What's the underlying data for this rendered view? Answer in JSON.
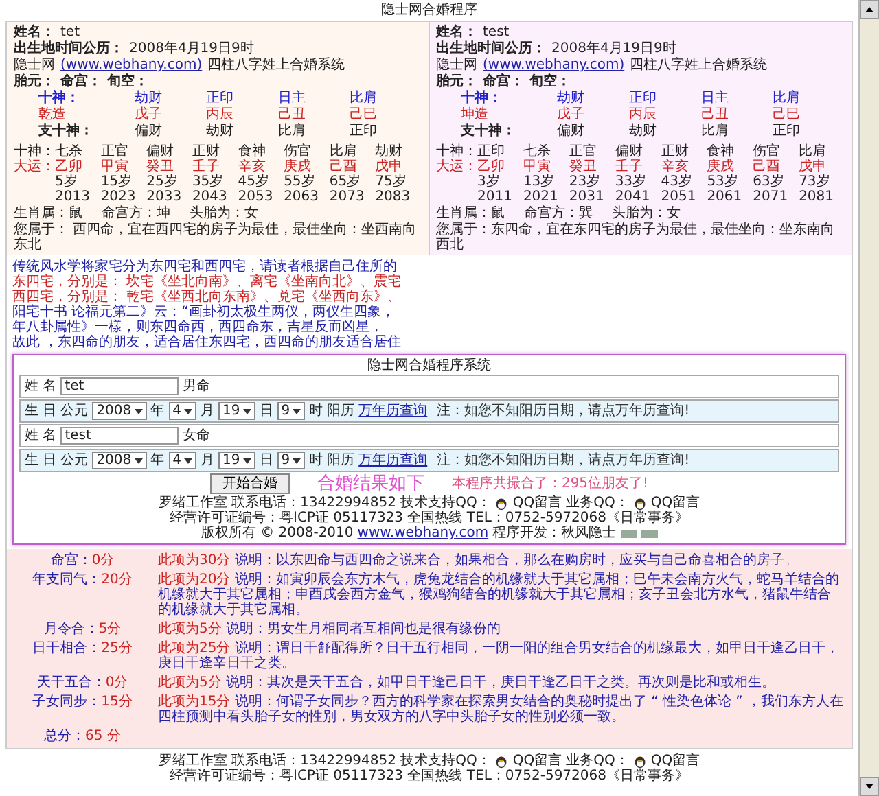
{
  "window": {
    "title": "隐士网合婚程序"
  },
  "panels": [
    {
      "name_label": "姓名：",
      "name": "tet",
      "birth_label": "出生地时间公历：",
      "birth": "2008年4月19日9时",
      "site_prefix": "隐士网",
      "site_link": "(www.webhany.com)",
      "site_suffix": "四柱八字姓上合婚系统",
      "taiyuan": "胎元：",
      "minggong": "命宫：",
      "xunkong": "旬空：",
      "shishen_label": "十神：",
      "shishen": [
        "劫财",
        "正印",
        "日主",
        "比肩"
      ],
      "zao_label": "乾造",
      "pillars": [
        "戊子",
        "丙辰",
        "己丑",
        "己巳"
      ],
      "zhi_label": "支十神：",
      "zhi": [
        "偏财",
        "劫财",
        "比肩",
        "正印"
      ],
      "dayun_shishen_label": "十神：",
      "dayun_shishen": [
        "七杀",
        "正官",
        "偏财",
        "正财",
        "食神",
        "伤官",
        "比肩",
        "劫财"
      ],
      "dayun_label": "大运：",
      "dayun": [
        "乙卯",
        "甲寅",
        "癸丑",
        "壬子",
        "辛亥",
        "庚戌",
        "己酉",
        "戊申"
      ],
      "ages": [
        "5岁",
        "15岁",
        "25岁",
        "35岁",
        "45岁",
        "55岁",
        "65岁",
        "75岁"
      ],
      "years": [
        "2013",
        "2023",
        "2033",
        "2043",
        "2053",
        "2063",
        "2073",
        "2083"
      ],
      "zodiac": "生肖属：鼠",
      "direction": "命宫方：坤",
      "first_child": "头胎为：女",
      "summary": "您属于： 西四命，宜在西四宅的房子为最佳，最佳坐向：坐西南向东北"
    },
    {
      "name_label": "姓名：",
      "name": "test",
      "birth_label": "出生地时间公历：",
      "birth": "2008年4月19日9时",
      "site_prefix": "隐士网",
      "site_link": "(www.webhany.com)",
      "site_suffix": "四柱八字姓上合婚系统",
      "taiyuan": "胎元：",
      "minggong": "命宫：",
      "xunkong": "旬空：",
      "shishen_label": "十神：",
      "shishen": [
        "劫财",
        "正印",
        "日主",
        "比肩"
      ],
      "zao_label": "坤造",
      "pillars": [
        "戊子",
        "丙辰",
        "己丑",
        "己巳"
      ],
      "zhi_label": "支十神：",
      "zhi": [
        "偏财",
        "劫财",
        "比肩",
        "正印"
      ],
      "dayun_shishen_label": "十神：",
      "dayun_shishen": [
        "正印",
        "七杀",
        "正官",
        "偏财",
        "正财",
        "食神",
        "伤官",
        "比肩"
      ],
      "dayun_label": "大运：",
      "dayun": [
        "乙卯",
        "甲寅",
        "癸丑",
        "壬子",
        "辛亥",
        "庚戌",
        "己酉",
        "戊申"
      ],
      "ages": [
        "3岁",
        "13岁",
        "23岁",
        "33岁",
        "43岁",
        "53岁",
        "63岁",
        "73岁"
      ],
      "years": [
        "2011",
        "2021",
        "2031",
        "2041",
        "2051",
        "2061",
        "2071",
        "2081"
      ],
      "zodiac": "生肖属：鼠",
      "direction": "命宫方：巽",
      "first_child": "头胎为：女",
      "summary": "您属于：东四命，宜在东四宅的房子为最佳，最佳坐向：坐东南向西北"
    }
  ],
  "notes": [
    {
      "kind": "plain",
      "text": "传统风水学将家宅分为东四宅和西四宅，请读者根据自己住所的"
    },
    {
      "kind": "emphasis",
      "text": "东四宅，分别是：  坎宅《坐北向南》、离宅《坐南向北》、震宅"
    },
    {
      "kind": "emphasis",
      "text": "西四宅，分别是：  乾宅《坐西北向东南》、兑宅《坐西向东》、"
    },
    {
      "kind": "plain",
      "text": "阳宅十书 论福元第二》云：“画卦初太极生两仪，两仪生四象，"
    },
    {
      "kind": "plain",
      "text": "年八卦属性》一樣，则东四命西，西四命东，吉星反而凶星，"
    },
    {
      "kind": "plain",
      "text": "故此 ，东四命的朋友，适合居住东四宅，西四命的朋友适合居住"
    }
  ],
  "dialog": {
    "title": "隐士网合婚程序系统",
    "rows": [
      {
        "kind": "name",
        "label": "姓 名",
        "value": "tet",
        "gender": "男命"
      },
      {
        "kind": "birth",
        "label": "生 日",
        "era": "公元",
        "year": "2008",
        "year_unit": "年",
        "month": "4",
        "month_unit": "月",
        "day": "19",
        "day_unit": "日",
        "hour": "9",
        "hour_unit": "时",
        "calendar": "阳历",
        "lookup_link": "万年历查询",
        "note": "注：如您不知阳历日期，请点万年历查询!"
      },
      {
        "kind": "name",
        "label": "姓 名",
        "value": "test",
        "gender": "女命"
      },
      {
        "kind": "birth",
        "label": "生 日",
        "era": "公元",
        "year": "2008",
        "year_unit": "年",
        "month": "4",
        "month_unit": "月",
        "day": "19",
        "day_unit": "日",
        "hour": "9",
        "hour_unit": "时",
        "calendar": "阳历",
        "lookup_link": "万年历查询",
        "note": "注：如您不知阳历日期，请点万年历查询!"
      }
    ],
    "button": "开始合婚",
    "result_heading": "合婚结果如下",
    "counter": "本程序共撮合了：295位朋友了!",
    "footer": {
      "contact": "罗绪工作室 联系电话：13422994852 技术支持QQ：",
      "qq1": "QQ留言",
      "biz": "业务QQ：",
      "qq2": "QQ留言",
      "license": "经营许可证编号：粤ICP证 05117323 全国热线 TEL：0752-5972068《日常事务》",
      "copyright": "版权所有 © 2008-2010",
      "site": "www.webhany.com",
      "developer": "程序开发：秋风隐士"
    }
  },
  "results": [
    {
      "label": "命宫：",
      "score": "0分",
      "item_score": "此项为30分",
      "desc": "说明：以东四命与西四命之说来合，如果相合，那么在购房时，应买与自己命喜相合的房子。"
    },
    {
      "label": "年支同气：",
      "score": "20分",
      "item_score": "此项为20分",
      "desc": "说明：如寅卯辰会东方木气，虎兔龙结合的机缘就大于其它属相；巳午未会南方火气，蛇马羊结合的机缘就大于其它属相；申酉戌会西方金气，猴鸡狗结合的机缘就大于其它属相；亥子丑会北方水气，猪鼠牛结合的机缘就大于其它属相。"
    },
    {
      "label": "月令合：",
      "score": "5分",
      "item_score": "此项为5分",
      "desc": "说明：男女生月相同者互相间也是很有缘份的"
    },
    {
      "label": "日干相合：",
      "score": "25分",
      "item_score": "此项为25分",
      "desc": "说明：谓日干舒配得所？日干五行相同，一阴一阳的组合男女结合的机缘最大，如甲日干逢乙日干，庚日干逢辛日干之类。"
    },
    {
      "label": "天干五合：",
      "score": "0分",
      "item_score": "此项为5分",
      "desc": "说明：其次是天干五合，如甲日干逢己日干，庚日干逢乙日干之类。再次则是比和或相生。"
    },
    {
      "label": "子女同步：",
      "score": "15分",
      "item_score": "此项为15分",
      "desc": "说明：何谓子女同步？西方的科学家在探索男女结合的奥秘时提出了 “ 性染色体论 ” ，我们东方人在四柱预测中看头胎子女的性别，男女双方的八字中头胎子女的性别必须一致。"
    }
  ],
  "total": {
    "label": "总分：",
    "score": "65 分"
  },
  "footer": {
    "contact": "罗绪工作室 联系电话：13422994852 技术支持QQ：",
    "qq1": "QQ留言",
    "biz": "业务QQ：",
    "qq2": "QQ留言",
    "license": "经营许可证编号：粤ICP证 05117323 全国热线 TEL：0752-5972068《日常事务》"
  }
}
